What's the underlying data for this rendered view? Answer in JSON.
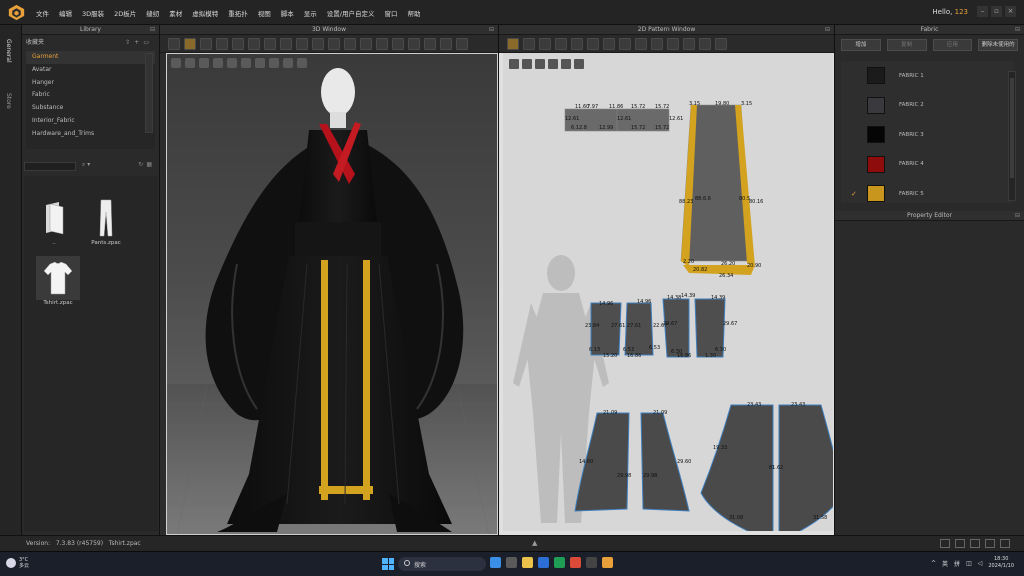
{
  "menu": {
    "items": [
      "文件",
      "编辑",
      "3D服装",
      "2D板片",
      "缝纫",
      "素材",
      "虚拟模特",
      "重拓扑",
      "视图",
      "脚本",
      "显示",
      "设置/用户自定义",
      "窗口",
      "帮助"
    ],
    "greeting_prefix": "Hello,",
    "user": "123"
  },
  "side_tabs": [
    "General",
    "Store"
  ],
  "library": {
    "title": "Library",
    "favorites_label": "收藏夹",
    "tree": [
      "Garment",
      "Avatar",
      "Hanger",
      "Fabric",
      "Substance",
      "Interior_Fabric",
      "Hardware_and_Trims"
    ],
    "active": "Garment",
    "files": [
      {
        "name": "..",
        "icon": "folder-icon"
      },
      {
        "name": "Pants.zpac",
        "icon": "pants-icon"
      },
      {
        "name": "Tshirt.zpac",
        "icon": "tshirt-icon"
      }
    ]
  },
  "view3d": {
    "title": "3D Window"
  },
  "view2d": {
    "title": "2D Pattern Window",
    "measurements": {
      "top_piece": [
        "11.60",
        "7.97",
        "11.86",
        "15.72",
        "15.72",
        "12.61",
        "12.61",
        "12.61",
        "6.12.8",
        "12.99",
        "15.72",
        "15.72"
      ],
      "skirt_top": [
        "3.15",
        "19.80",
        "3.15"
      ],
      "skirt_mid": [
        "88.23",
        "88.6.6",
        "80.5",
        "80.16"
      ],
      "skirt_bottom": [
        "2.20",
        "20.82",
        "26.20",
        "20.90",
        "26.34"
      ],
      "sleeves": [
        "14.96",
        "14.96",
        "14.38",
        "14.39",
        "14.39",
        "23.84",
        "27.61",
        "27.61",
        "22.67",
        "29.67",
        "29.67",
        "6.13",
        "6.53",
        "6.53",
        "6.30",
        "6.30",
        "15.20",
        "16.86",
        "16.86",
        "1.30"
      ],
      "lower_left": [
        "21.09",
        "21.09",
        "14.60",
        "29.60",
        "29.98",
        "29.98"
      ],
      "lower_right": [
        "23.43",
        "23.43",
        "19.33",
        "81.62",
        "31.08",
        "31.58"
      ]
    }
  },
  "fabric": {
    "title": "Fabric",
    "buttons": [
      "增加",
      "复制",
      "应用",
      "删除未使用的"
    ],
    "items": [
      {
        "name": "FABRIC 1",
        "color": "#1b1b1b"
      },
      {
        "name": "FABRIC 2",
        "color": "#3a3a3e"
      },
      {
        "name": "FABRIC 3",
        "color": "#050505"
      },
      {
        "name": "FABRIC 4",
        "color": "#8e0c0c"
      },
      {
        "name": "FABRIC 5",
        "color": "#c8961c",
        "checked": true
      }
    ]
  },
  "property": {
    "title": "Property Editor"
  },
  "status": {
    "version_label": "Version:",
    "version": "7.3.83 (r45759)",
    "file": "Tshirt.zpac"
  },
  "taskbar": {
    "weather_temp": "3°C",
    "weather_desc": "多云",
    "search_label": "搜索",
    "lang1": "英",
    "lang2": "拼",
    "time": "18:30",
    "date": "2024/1/10"
  }
}
